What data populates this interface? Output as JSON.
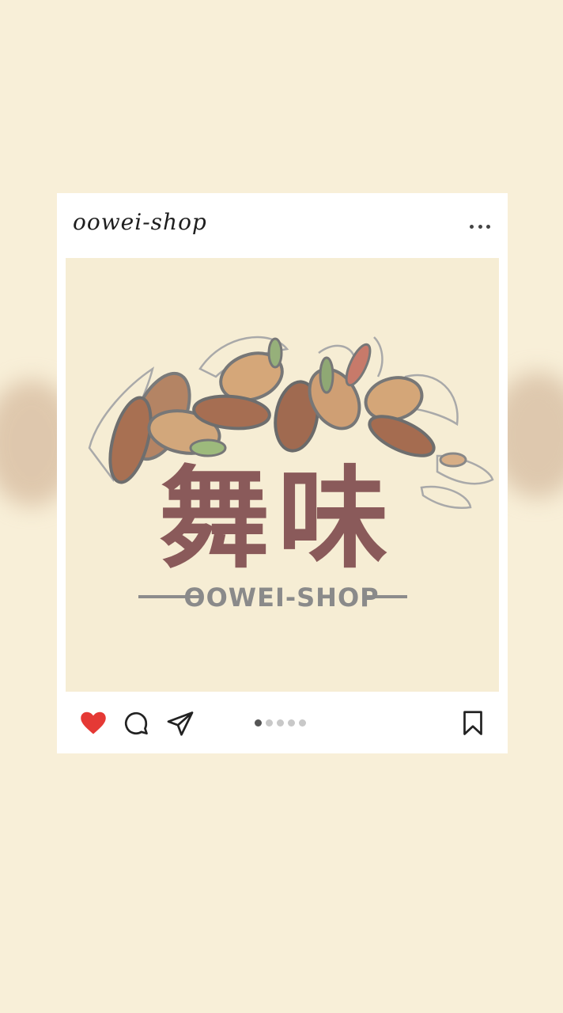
{
  "post": {
    "username": "oowei-shop",
    "more_icon": "more-horizontal-icon",
    "logo": {
      "title_chinese": "舞味",
      "subtitle": "OOWEI-SHOP"
    },
    "actions": {
      "like_icon": "heart-filled-icon",
      "comment_icon": "comment-bubble-icon",
      "share_icon": "send-paper-plane-icon",
      "save_icon": "bookmark-icon",
      "liked": true
    },
    "carousel": {
      "count": 5,
      "active_index": 0
    }
  },
  "colors": {
    "background": "#f8efd8",
    "card": "#ffffff",
    "image_background": "#f6edd4",
    "logo_text": "#8a5a5a",
    "like": "#e53935"
  }
}
